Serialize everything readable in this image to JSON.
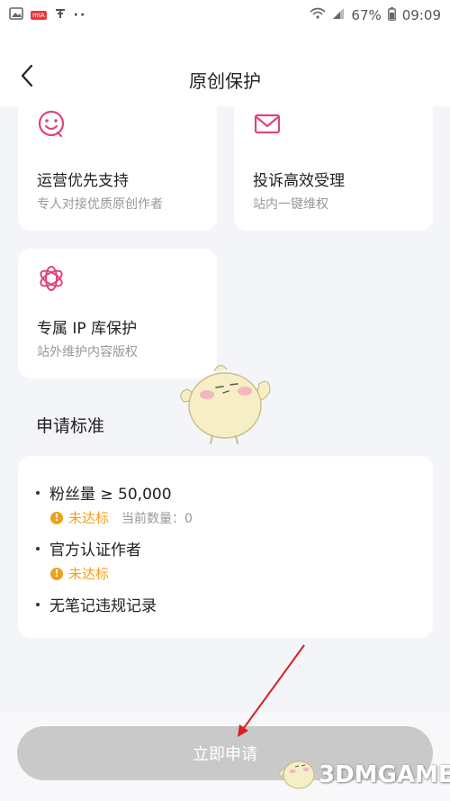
{
  "status_bar": {
    "battery": "67%",
    "time": "09:09",
    "app_badge": "mIA",
    "dots": "··",
    "icons": [
      "gallery-icon",
      "app-badge-icon",
      "pin-icon",
      "wifi-icon",
      "signal-icon",
      "battery-icon"
    ]
  },
  "nav": {
    "title": "原创保护",
    "back_icon": "chevron-left-icon"
  },
  "benefits": [
    {
      "icon": "smile-icon",
      "title": "运营优先支持",
      "subtitle": "专人对接优质原创作者"
    },
    {
      "icon": "mail-icon",
      "title": "投诉高效受理",
      "subtitle": "站内一键维权"
    },
    {
      "icon": "flower-icon",
      "title": "专属 IP 库保护",
      "subtitle": "站外维护内容版权"
    }
  ],
  "criteria": {
    "title": "申请标准",
    "items": [
      {
        "label": "粉丝量 ≥ 50,000",
        "status": "未达标",
        "extra": "当前数量：0"
      },
      {
        "label": "官方认证作者",
        "status": "未达标"
      },
      {
        "label": "无笔记违规记录"
      }
    ]
  },
  "apply_button": {
    "label": "立即申请"
  },
  "watermark": {
    "text": "3DMGAME"
  },
  "colors": {
    "accent": "#e0457a",
    "warning": "#f0a020",
    "disabled_button": "#c9c9c9"
  }
}
